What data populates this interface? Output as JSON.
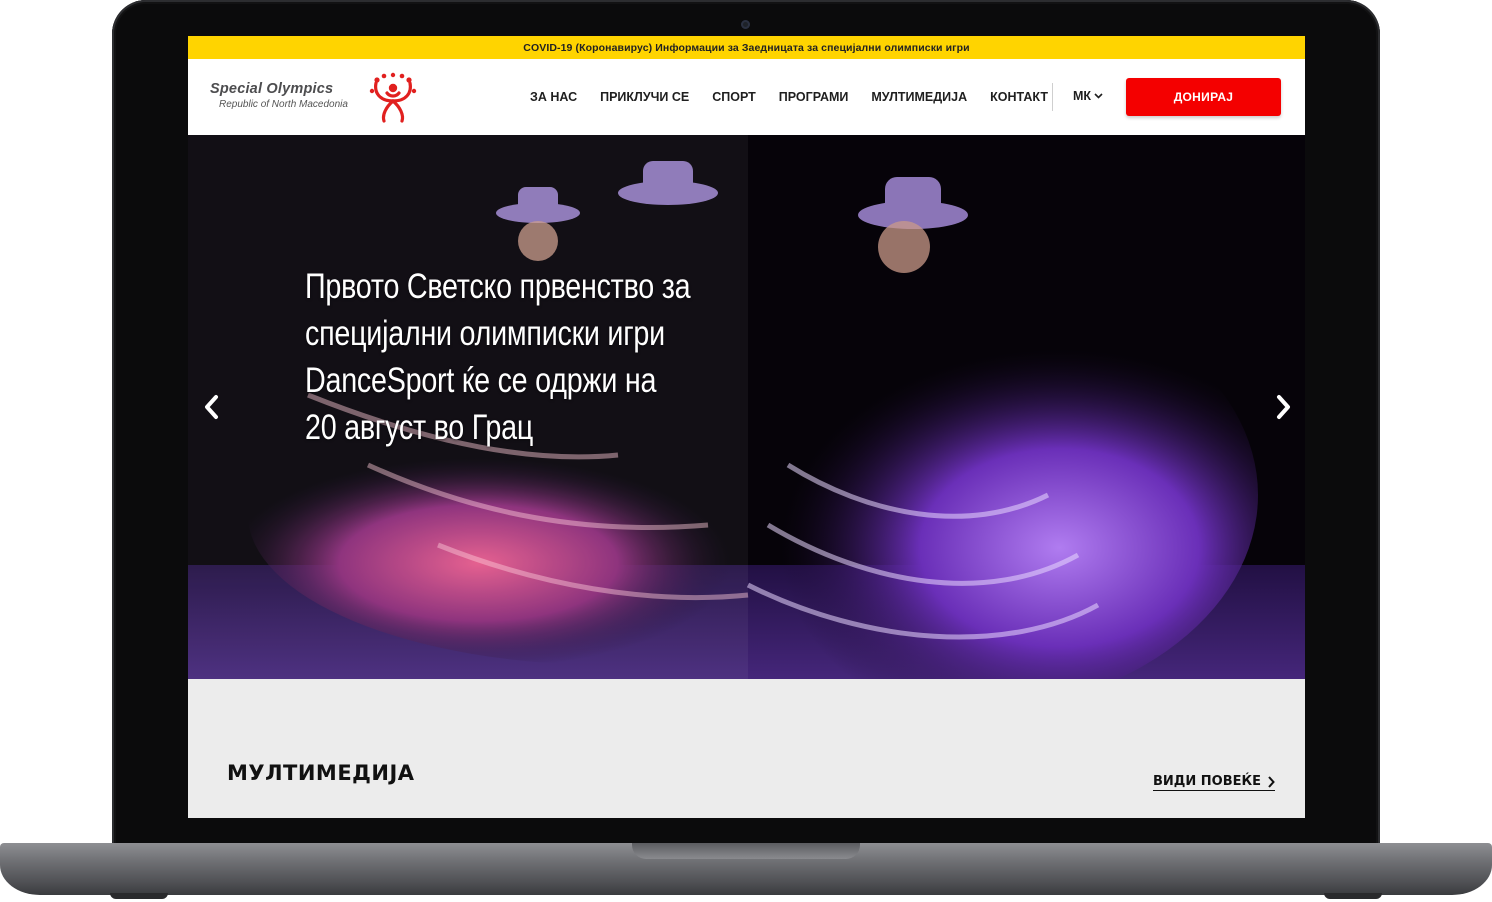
{
  "covid_banner": "COVID-19 (Коронавирус) Информации за Заедницата за специјални олимписки игри",
  "logo": {
    "line1": "Special Olympics",
    "line2": "Republic of North Macedonia",
    "mark": "special-olympics-logo-icon"
  },
  "nav": {
    "items": [
      "ЗА НАС",
      "ПРИКЛУЧИ СЕ",
      "СПОРТ",
      "ПРОГРАМИ",
      "МУЛТИМЕДИЈА",
      "КОНТАКТ"
    ],
    "language": "МК",
    "donate": "ДОНИРАЈ"
  },
  "hero": {
    "title": "Првото Светско првенство за специјални олимписки игри DanceSport ќе се одржи на 20 август во Грац",
    "prev_icon": "chevron-left-icon",
    "next_icon": "chevron-right-icon"
  },
  "multimedia": {
    "title": "МУЛТИМЕДИЈА",
    "see_more": "ВИДИ ПОВЕЌЕ"
  },
  "colors": {
    "banner": "#ffd400",
    "donate": "#f40000",
    "section_bg": "#ececec",
    "logo_red": "#e1201f"
  }
}
